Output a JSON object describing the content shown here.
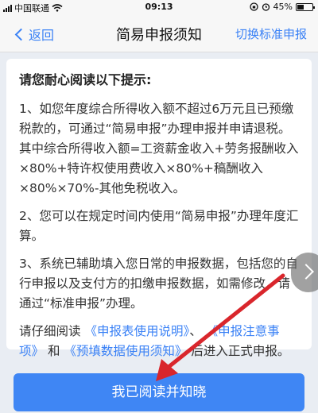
{
  "status_bar": {
    "carrier": "中国联通",
    "time": "09:13",
    "battery_text": "45%",
    "battery_level": 0.45
  },
  "nav": {
    "back_label": "返回",
    "title": "简易申报须知",
    "right_label": "切换标准申报"
  },
  "notice": {
    "heading": "请您耐心阅读以下提示:",
    "item1": "1、如您年度综合所得收入额不超过6万元且已预缴税款的，可通过“简易申报”办理申报并申请退税。其中综合所得收入额=工资薪金收入+劳务报酬收入×80%+特许权使用费收入×80%+稿酬收入×80%×70%-其他免税收入。",
    "item2": "2、您可以在规定时间内使用“简易申报”办理年度汇算。",
    "item3": "3、系统已辅助填入您日常的申报数据，包括您的自行申报以及支付方的扣缴申报数据，如需修改，请通过“标准申报”办理。",
    "footer_prefix": "请仔细阅读",
    "link1": "《申报表使用说明》",
    "sep1": "、",
    "link2": "《申报注意事项》",
    "and": "和",
    "link3": "《预填数据使用须知》",
    "footer_suffix": "后进入正式申报。"
  },
  "confirm_button_label": "我已阅读并知晓",
  "colors": {
    "accent": "#3b82f6",
    "button": "#3f86f4",
    "annotation_arrow": "#d9262c"
  }
}
